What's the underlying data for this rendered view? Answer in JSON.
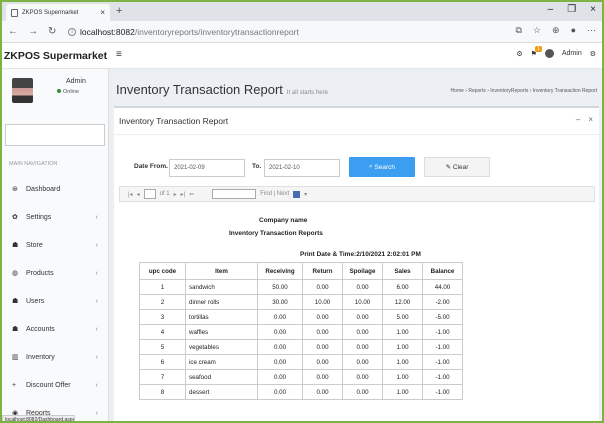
{
  "browser": {
    "tab_title": "ZKPOS Supermarket",
    "tab_close": "×",
    "new_tab": "+",
    "url_host": "localhost:8082",
    "url_path": "/inventoryreports/inventorytransactionreport",
    "win_min": "–",
    "win_max": "❐",
    "win_close": "×"
  },
  "app": {
    "brand": "ZKPOS Supermarket",
    "user_name": "Admin",
    "user_status": "Online",
    "header_user": "Admin",
    "notif_count": "1"
  },
  "sidebar": {
    "heading": "MAIN NAVIGATION",
    "items": [
      {
        "label": "Dashboard",
        "icon": "dashboard-icon",
        "glyph": "⊛",
        "chevron": ""
      },
      {
        "label": "Settings",
        "icon": "gear-icon",
        "glyph": "✿",
        "chevron": "‹"
      },
      {
        "label": "Store",
        "icon": "users-icon",
        "glyph": "☗",
        "chevron": "‹"
      },
      {
        "label": "Products",
        "icon": "box-icon",
        "glyph": "◍",
        "chevron": "‹"
      },
      {
        "label": "Users",
        "icon": "users-icon",
        "glyph": "☗",
        "chevron": "‹"
      },
      {
        "label": "Accounts",
        "icon": "users-icon",
        "glyph": "☗",
        "chevron": "‹"
      },
      {
        "label": "Inventory",
        "icon": "bank-icon",
        "glyph": "▥",
        "chevron": "‹"
      },
      {
        "label": "Discount Offer",
        "icon": "plus-icon",
        "glyph": "+",
        "chevron": "‹"
      },
      {
        "label": "Reports",
        "icon": "eye-icon",
        "glyph": "◉",
        "chevron": "‹"
      }
    ],
    "status_url": "localhost:8082/Dashboard.aspx"
  },
  "page": {
    "title": "Inventory Transaction Report",
    "subtitle": "It all starts here",
    "breadcrumb": "Home  ›  Reports  ›  InventoryReports  ›  Inventory Transaction Report"
  },
  "box": {
    "title": "Inventory Transaction Report",
    "collapse": "–",
    "remove": "×"
  },
  "filter": {
    "date_from_label": "Date From.",
    "date_from_value": "2021-02-09",
    "to_label": "To.",
    "to_value": "2021-02-10",
    "search_label": "Search",
    "clear_label": "Clear"
  },
  "viewer": {
    "page_of": "of 1",
    "find_label": "Find | Next"
  },
  "report": {
    "company": "Company name",
    "title": "Inventory Transaction Reports",
    "print_date": "Print Date & Time:2/10/2021 2:02:01 PM",
    "columns": [
      "upc code",
      "Item",
      "Receiving",
      "Return",
      "Spoilage",
      "Sales",
      "Balance"
    ],
    "rows": [
      [
        "1",
        "sandwich",
        "50.00",
        "0.00",
        "0.00",
        "6.00",
        "44.00"
      ],
      [
        "2",
        "dinner rolls",
        "30.00",
        "10.00",
        "10.00",
        "12.00",
        "-2.00"
      ],
      [
        "3",
        "tortillas",
        "0.00",
        "0.00",
        "0.00",
        "5.00",
        "-5.00"
      ],
      [
        "4",
        "waffles",
        "0.00",
        "0.00",
        "0.00",
        "1.00",
        "-1.00"
      ],
      [
        "5",
        "vegetables",
        "0.00",
        "0.00",
        "0.00",
        "1.00",
        "-1.00"
      ],
      [
        "6",
        "ice cream",
        "0.00",
        "0.00",
        "0.00",
        "1.00",
        "-1.00"
      ],
      [
        "7",
        "seafood",
        "0.00",
        "0.00",
        "0.00",
        "1.00",
        "-1.00"
      ],
      [
        "8",
        "dessert",
        "0.00",
        "0.00",
        "0.00",
        "1.00",
        "-1.00"
      ]
    ]
  }
}
